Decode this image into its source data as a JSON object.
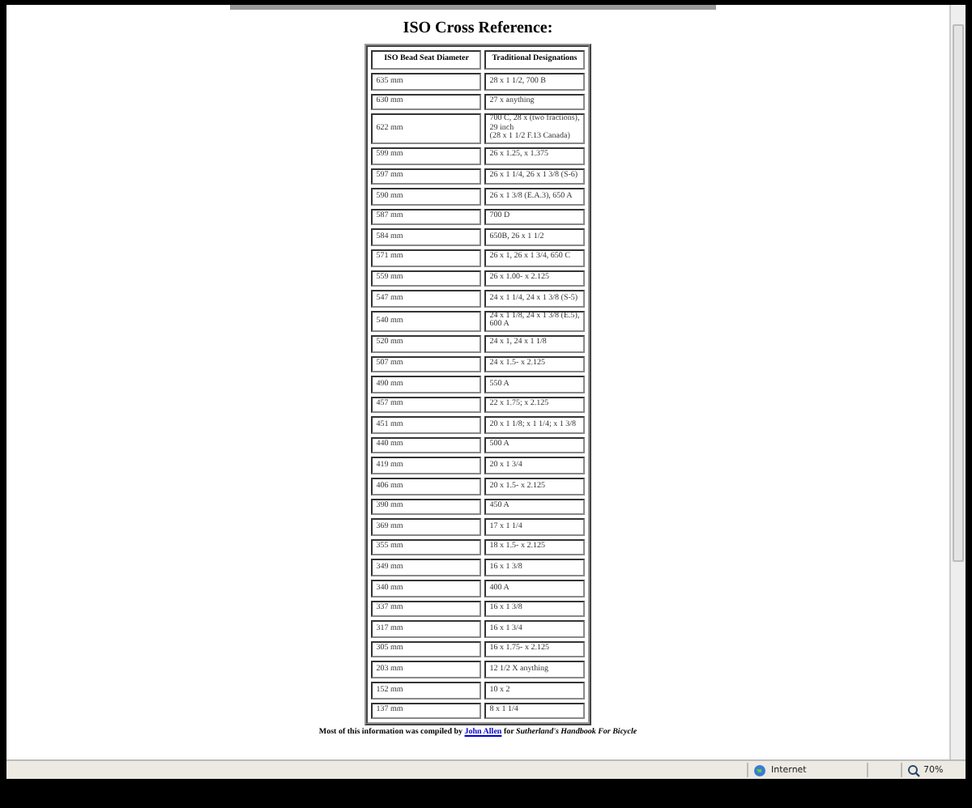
{
  "title": "ISO Cross Reference:",
  "table": {
    "columns": [
      "ISO Bead Seat Diameter",
      "Traditional Designations"
    ],
    "rows": [
      [
        "635 mm",
        "28 x 1 1/2, 700 B"
      ],
      [
        "630 mm",
        "27 x anything"
      ],
      [
        "622 mm",
        "700 C, 28 x (two fractions),\n29 inch\n(28 x 1 1/2 F.13 Canada)"
      ],
      [
        "599 mm",
        "26 x 1.25, x 1.375"
      ],
      [
        "597 mm",
        "26 x 1 1/4, 26 x 1 3/8 (S-6)"
      ],
      [
        "590 mm",
        "26 x 1 3/8 (E.A.3), 650 A"
      ],
      [
        "587 mm",
        "700 D"
      ],
      [
        "584 mm",
        "650B, 26 x 1 1/2"
      ],
      [
        "571 mm",
        "26 x 1, 26 x 1 3/4, 650 C"
      ],
      [
        "559 mm",
        "26 x 1.00- x 2.125"
      ],
      [
        "547 mm",
        "24 x 1 1/4, 24 x 1 3/8 (S-5)"
      ],
      [
        "540 mm",
        "24 x 1 1/8, 24 x 1 3/8 (E.5),\n600 A"
      ],
      [
        "520 mm",
        "24 x 1, 24 x 1 1/8"
      ],
      [
        "507 mm",
        "24 x 1.5- x 2.125"
      ],
      [
        "490 mm",
        "550 A"
      ],
      [
        "457 mm",
        "22 x 1.75; x 2.125"
      ],
      [
        "451 mm",
        "20 x 1 1/8; x 1 1/4; x 1 3/8"
      ],
      [
        "440 mm",
        "500 A"
      ],
      [
        "419 mm",
        "20 x 1 3/4"
      ],
      [
        "406 mm",
        "20 x 1.5- x 2.125"
      ],
      [
        "390 mm",
        "450 A"
      ],
      [
        "369 mm",
        "17 x 1 1/4"
      ],
      [
        "355 mm",
        "18 x 1.5- x 2.125"
      ],
      [
        "349 mm",
        "16 x 1 3/8"
      ],
      [
        "340 mm",
        "400 A"
      ],
      [
        "337 mm",
        "16 x 1 3/8"
      ],
      [
        "317 mm",
        "16 x 1 3/4"
      ],
      [
        "305 mm",
        "16 x 1.75- x 2.125"
      ],
      [
        "203 mm",
        "12 1/2 X anything"
      ],
      [
        "152 mm",
        "10 x 2"
      ],
      [
        "137 mm",
        "8 x 1 1/4"
      ]
    ]
  },
  "footer": {
    "before": "Most of this information was compiled by",
    "link": "John Allen",
    "middle": "for",
    "book": "Sutherland's Handbook For Bicycle"
  },
  "status_bar": {
    "zone": "Internet",
    "zoom": "70%"
  }
}
